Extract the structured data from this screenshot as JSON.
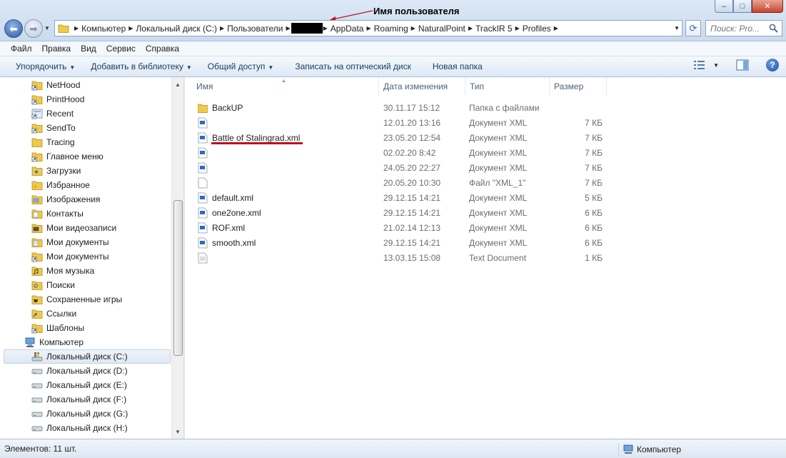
{
  "window": {
    "annotation": "Имя пользователя",
    "controls": {
      "minimize": "‒",
      "maximize": "□",
      "close": "✕"
    }
  },
  "address": {
    "crumbs": [
      "Компьютер",
      "Локальный диск (C:)",
      "Пользователи",
      "AppData",
      "Roaming",
      "NaturalPoint",
      "TrackIR 5",
      "Profiles"
    ]
  },
  "search": {
    "placeholder": "Поиск: Pro..."
  },
  "menu": [
    "Файл",
    "Правка",
    "Вид",
    "Сервис",
    "Справка"
  ],
  "commands": [
    {
      "label": "Упорядочить",
      "dropdown": true
    },
    {
      "label": "Добавить в библиотеку",
      "dropdown": true
    },
    {
      "label": "Общий доступ",
      "dropdown": true
    },
    {
      "label": "Записать на оптический диск",
      "dropdown": false
    },
    {
      "label": "Новая папка",
      "dropdown": false
    }
  ],
  "nav_items": [
    {
      "label": "NetHood",
      "icon": "shortcut-folder-icon"
    },
    {
      "label": "PrintHood",
      "icon": "shortcut-folder-icon"
    },
    {
      "label": "Recent",
      "icon": "shortcut-folder-icon"
    },
    {
      "label": "SendTo",
      "icon": "shortcut-folder-icon"
    },
    {
      "label": "Tracing",
      "icon": "folder-icon"
    },
    {
      "label": "Главное меню",
      "icon": "shortcut-folder-icon"
    },
    {
      "label": "Загрузки",
      "icon": "downloads-folder-icon"
    },
    {
      "label": "Избранное",
      "icon": "favorites-folder-icon"
    },
    {
      "label": "Изображения",
      "icon": "pictures-folder-icon"
    },
    {
      "label": "Контакты",
      "icon": "contacts-folder-icon"
    },
    {
      "label": "Мои видеозаписи",
      "icon": "videos-folder-icon"
    },
    {
      "label": "Мои документы",
      "icon": "documents-folder-icon"
    },
    {
      "label": "Мои документы",
      "icon": "shortcut-folder-icon"
    },
    {
      "label": "Моя музыка",
      "icon": "music-folder-icon"
    },
    {
      "label": "Поиски",
      "icon": "searches-folder-icon"
    },
    {
      "label": "Сохраненные игры",
      "icon": "saved-games-folder-icon"
    },
    {
      "label": "Ссылки",
      "icon": "links-folder-icon"
    },
    {
      "label": "Шаблоны",
      "icon": "shortcut-folder-icon"
    },
    {
      "label": "Компьютер",
      "icon": "computer-icon"
    },
    {
      "label": "Локальный диск (C:)",
      "icon": "system-drive-icon",
      "selected": true
    },
    {
      "label": "Локальный диск (D:)",
      "icon": "drive-icon"
    },
    {
      "label": "Локальный диск (E:)",
      "icon": "drive-icon"
    },
    {
      "label": "Локальный диск (F:)",
      "icon": "drive-icon"
    },
    {
      "label": "Локальный диск (G:)",
      "icon": "drive-icon"
    },
    {
      "label": "Локальный диск (H:)",
      "icon": "drive-icon"
    }
  ],
  "columns": {
    "name": "Имя",
    "date": "Дата изменения",
    "type": "Тип",
    "size": "Размер"
  },
  "files": [
    {
      "name": "BackUP",
      "date": "30.11.17 15:12",
      "type": "Папка с файлами",
      "size": "",
      "icon": "folder-icon"
    },
    {
      "name": "",
      "date": "12.01.20 13:16",
      "type": "Документ XML",
      "size": "7 КБ",
      "icon": "xml-file-icon"
    },
    {
      "name": "Battle of Stalingrad.xml",
      "date": "23.05.20 12:54",
      "type": "Документ XML",
      "size": "7 КБ",
      "icon": "xml-file-icon"
    },
    {
      "name": "",
      "date": "02.02.20 8:42",
      "type": "Документ XML",
      "size": "7 КБ",
      "icon": "xml-file-icon"
    },
    {
      "name": "",
      "date": "24.05.20 22:27",
      "type": "Документ XML",
      "size": "7 КБ",
      "icon": "xml-file-icon"
    },
    {
      "name": "",
      "date": "20.05.20 10:30",
      "type": "Файл \"XML_1\"",
      "size": "7 КБ",
      "icon": "blank-file-icon"
    },
    {
      "name": "default.xml",
      "date": "29.12.15 14:21",
      "type": "Документ XML",
      "size": "5 КБ",
      "icon": "xml-file-icon"
    },
    {
      "name": "one2one.xml",
      "date": "29.12.15 14:21",
      "type": "Документ XML",
      "size": "6 КБ",
      "icon": "xml-file-icon"
    },
    {
      "name": "ROF.xml",
      "date": "21.02.14 12:13",
      "type": "Документ XML",
      "size": "6 КБ",
      "icon": "xml-file-icon"
    },
    {
      "name": "smooth.xml",
      "date": "29.12.15 14:21",
      "type": "Документ XML",
      "size": "6 КБ",
      "icon": "xml-file-icon"
    },
    {
      "name": "",
      "date": "13.03.15 15:08",
      "type": "Text Document",
      "size": "1 КБ",
      "icon": "text-file-icon"
    }
  ],
  "status": {
    "count": "Элементов: 11 шт.",
    "location": "Компьютер"
  },
  "colors": {
    "accent": "#1e395b",
    "highlight_underline": "#c0111d",
    "chrome": "#dce8f5"
  }
}
